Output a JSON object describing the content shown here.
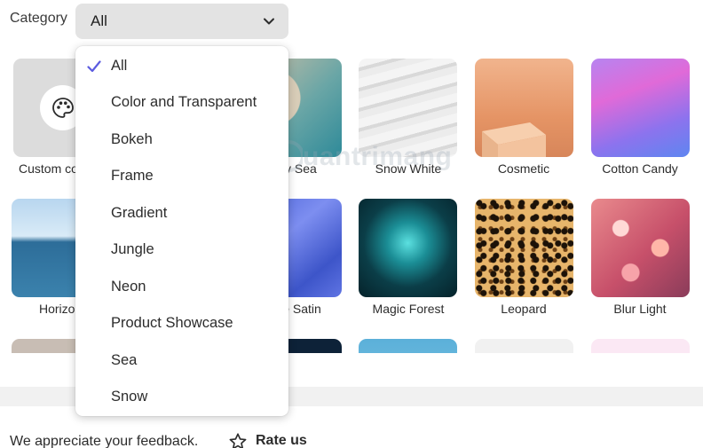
{
  "filter": {
    "label": "Category",
    "selected": "All"
  },
  "dropdown": {
    "options": [
      {
        "label": "All",
        "selected": true
      },
      {
        "label": "Color and Transparent",
        "selected": false
      },
      {
        "label": "Bokeh",
        "selected": false
      },
      {
        "label": "Frame",
        "selected": false
      },
      {
        "label": "Gradient",
        "selected": false
      },
      {
        "label": "Jungle",
        "selected": false
      },
      {
        "label": "Neon",
        "selected": false
      },
      {
        "label": "Product Showcase",
        "selected": false
      },
      {
        "label": "Sea",
        "selected": false
      },
      {
        "label": "Snow",
        "selected": false
      }
    ],
    "check_color": "#5c5ce0"
  },
  "grid": {
    "tiles": [
      {
        "label": "Custom co",
        "icon": "palette-icon"
      },
      {
        "label": "dy Sea"
      },
      {
        "label": "Snow White"
      },
      {
        "label": "Cosmetic"
      },
      {
        "label": "Cotton Candy"
      },
      {
        "label": "Horizo"
      },
      {
        "label": "e Satin"
      },
      {
        "label": "Magic Forest"
      },
      {
        "label": "Leopard"
      },
      {
        "label": "Blur Light"
      }
    ]
  },
  "watermark": {
    "text": "uantrimang"
  },
  "footer": {
    "feedback_text": "We appreciate your feedback.",
    "rate_label": "Rate us",
    "rate_icon": "star-outline-icon"
  }
}
